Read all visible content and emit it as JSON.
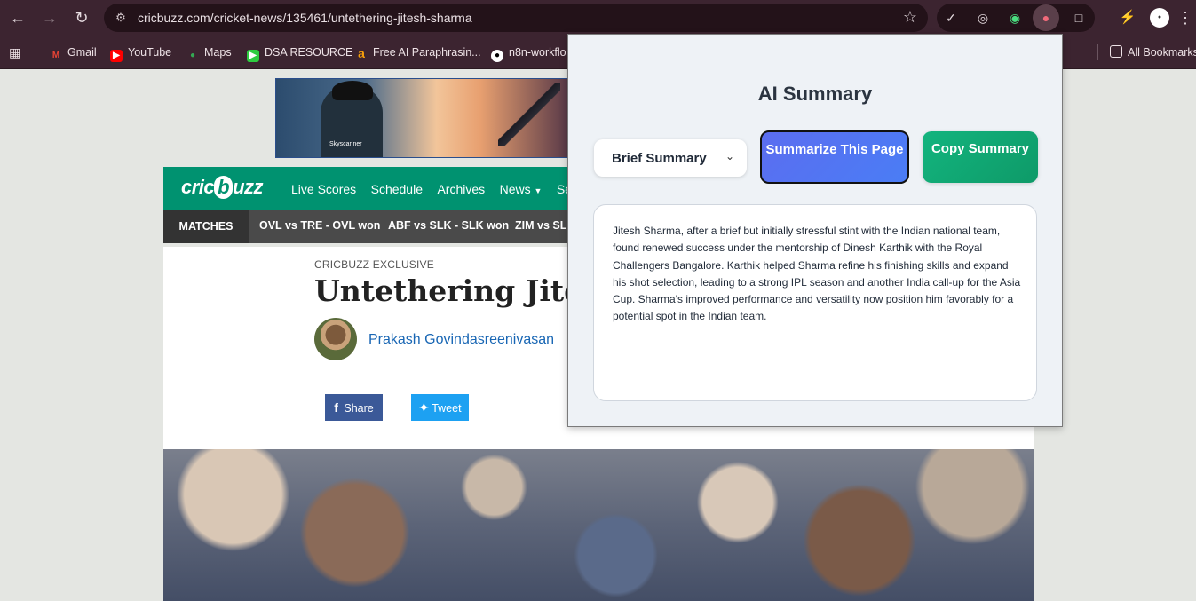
{
  "browser": {
    "url": "cricbuzz.com/cricket-news/135461/untethering-jitesh-sharma",
    "bookmarks": [
      {
        "label": "Gmail",
        "icon": "gmail-icon",
        "color": "#ea4335"
      },
      {
        "label": "YouTube",
        "icon": "youtube-icon",
        "color": "#ff0000"
      },
      {
        "label": "Maps",
        "icon": "maps-icon",
        "color": "#34a853"
      },
      {
        "label": "DSA RESOURCE",
        "icon": "dsa-icon",
        "color": "#2ecc40"
      },
      {
        "label": "Free AI Paraphrasin...",
        "icon": "paraphrase-icon",
        "color": "#f59e0b"
      },
      {
        "label": "n8n-workflo",
        "icon": "github-icon",
        "color": "#ffffff"
      }
    ],
    "all_bookmarks_label": "All Bookmarks"
  },
  "page": {
    "site_logo": {
      "pre": "cric",
      "mid": "b",
      "post": "uzz"
    },
    "nav": [
      "Live Scores",
      "Schedule",
      "Archives",
      "News",
      "Series"
    ],
    "matches_label": "MATCHES",
    "matches": [
      "OVL vs TRE - OVL won",
      "ABF vs SLK - SLK won",
      "ZIM vs SL -"
    ],
    "kicker": "CRICBUZZ EXCLUSIVE",
    "headline": "Untethering Jitesh Sharma",
    "author": "Prakash Govindasreenivasan",
    "share_label": "Share",
    "tweet_label": "Tweet",
    "ad_brand": "Skyscanner"
  },
  "popup": {
    "title": "AI Summary",
    "mode_selected": "Brief Summary",
    "summarize_label": "Summarize This Page",
    "copy_label": "Copy Summary",
    "summary": "Jitesh Sharma, after a brief but initially stressful stint with the Indian national team, found renewed success under the mentorship of Dinesh Karthik with the Royal Challengers Bangalore.  Karthik helped Sharma refine his finishing skills and expand his shot selection, leading to a strong IPL season and another India call-up for the Asia Cup.  Sharma's improved performance and versatility now position him favorably for a potential spot in the Indian team.",
    "colors": {
      "summarize": "#5b6df0",
      "copy": "#10a874"
    }
  }
}
